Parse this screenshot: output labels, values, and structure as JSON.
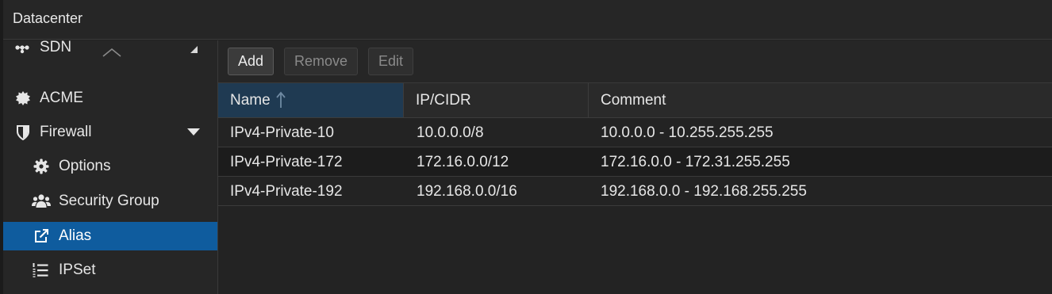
{
  "header": {
    "title": "Datacenter"
  },
  "sidebar": {
    "items": [
      {
        "label": "SDN",
        "icon": "sdn-icon"
      },
      {
        "label": "ACME",
        "icon": "certificate-icon"
      },
      {
        "label": "Firewall",
        "icon": "shield-icon"
      },
      {
        "label": "Options",
        "icon": "gear-icon"
      },
      {
        "label": "Security Group",
        "icon": "group-icon"
      },
      {
        "label": "Alias",
        "icon": "external-link-icon",
        "selected": true
      },
      {
        "label": "IPSet",
        "icon": "numbered-list-icon"
      }
    ]
  },
  "toolbar": {
    "add_label": "Add",
    "remove_label": "Remove",
    "edit_label": "Edit"
  },
  "grid": {
    "columns": [
      {
        "label": "Name",
        "sorted": "ascending"
      },
      {
        "label": "IP/CIDR"
      },
      {
        "label": "Comment"
      }
    ],
    "rows": [
      {
        "name": "IPv4-Private-10",
        "cidr": "10.0.0.0/8",
        "comment": "10.0.0.0 - 10.255.255.255"
      },
      {
        "name": "IPv4-Private-172",
        "cidr": "172.16.0.0/12",
        "comment": "172.16.0.0 - 172.31.255.255"
      },
      {
        "name": "IPv4-Private-192",
        "cidr": "192.168.0.0/16",
        "comment": "192.168.0.0 - 192.168.255.255"
      }
    ]
  },
  "colors": {
    "selected": "#0f5c9e",
    "sorted_header": "#1f3a52",
    "background": "#232323"
  }
}
